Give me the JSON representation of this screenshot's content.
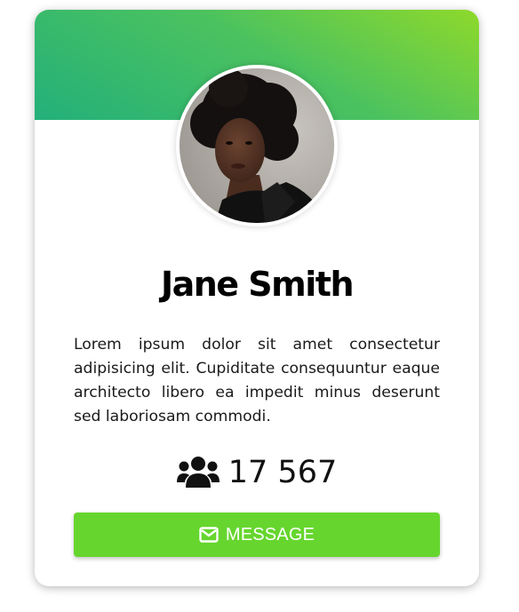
{
  "profile": {
    "name": "Jane Smith",
    "bio": "Lorem ipsum dolor sit amet consectetur adipisicing elit. Cupiditate consequuntur eaque architecto libero ea impedit minus deserunt sed laboriosam commodi.",
    "avatar_icon": "profile-photo",
    "followers_icon": "users-icon",
    "followers_count": "17 567"
  },
  "actions": {
    "message_label": "MESSAGE",
    "message_icon": "envelope-icon"
  },
  "colors": {
    "header_gradient_start": "#8ed92b",
    "header_gradient_end": "#23b07a",
    "button_green": "#66d62e",
    "card_background": "#ffffff"
  }
}
